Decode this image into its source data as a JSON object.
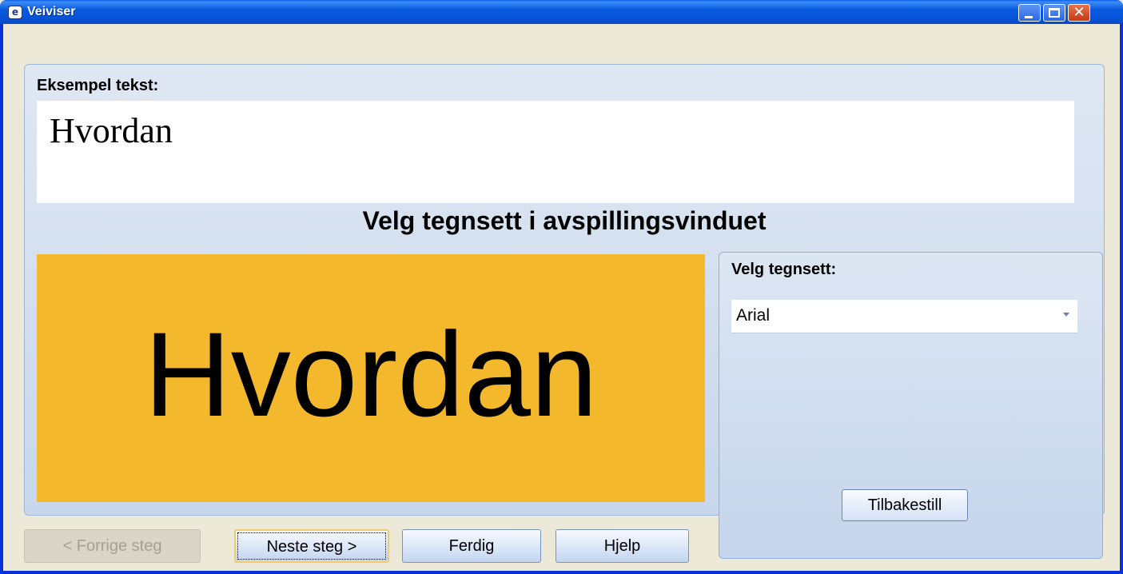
{
  "window": {
    "title": "Veiviser",
    "close_glyph": "✕"
  },
  "sample": {
    "label": "Eksempel tekst:",
    "text": "Hvordan"
  },
  "heading": "Velg tegnsett i avspillingsvinduet",
  "preview": {
    "text": "Hvordan",
    "background_color": "#f4b82c"
  },
  "font_panel": {
    "label": "Velg tegnsett:",
    "selected_font": "Arial",
    "reset_label": "Tilbakestill"
  },
  "buttons": {
    "prev_label": "< Forrige steg",
    "next_label": "Neste steg >",
    "finish_label": "Ferdig",
    "help_label": "Hjelp"
  },
  "icons": {
    "app": "app-icon",
    "minimize": "minimize-icon",
    "maximize": "maximize-icon",
    "close": "close-icon",
    "dropdown": "chevron-down-icon"
  }
}
